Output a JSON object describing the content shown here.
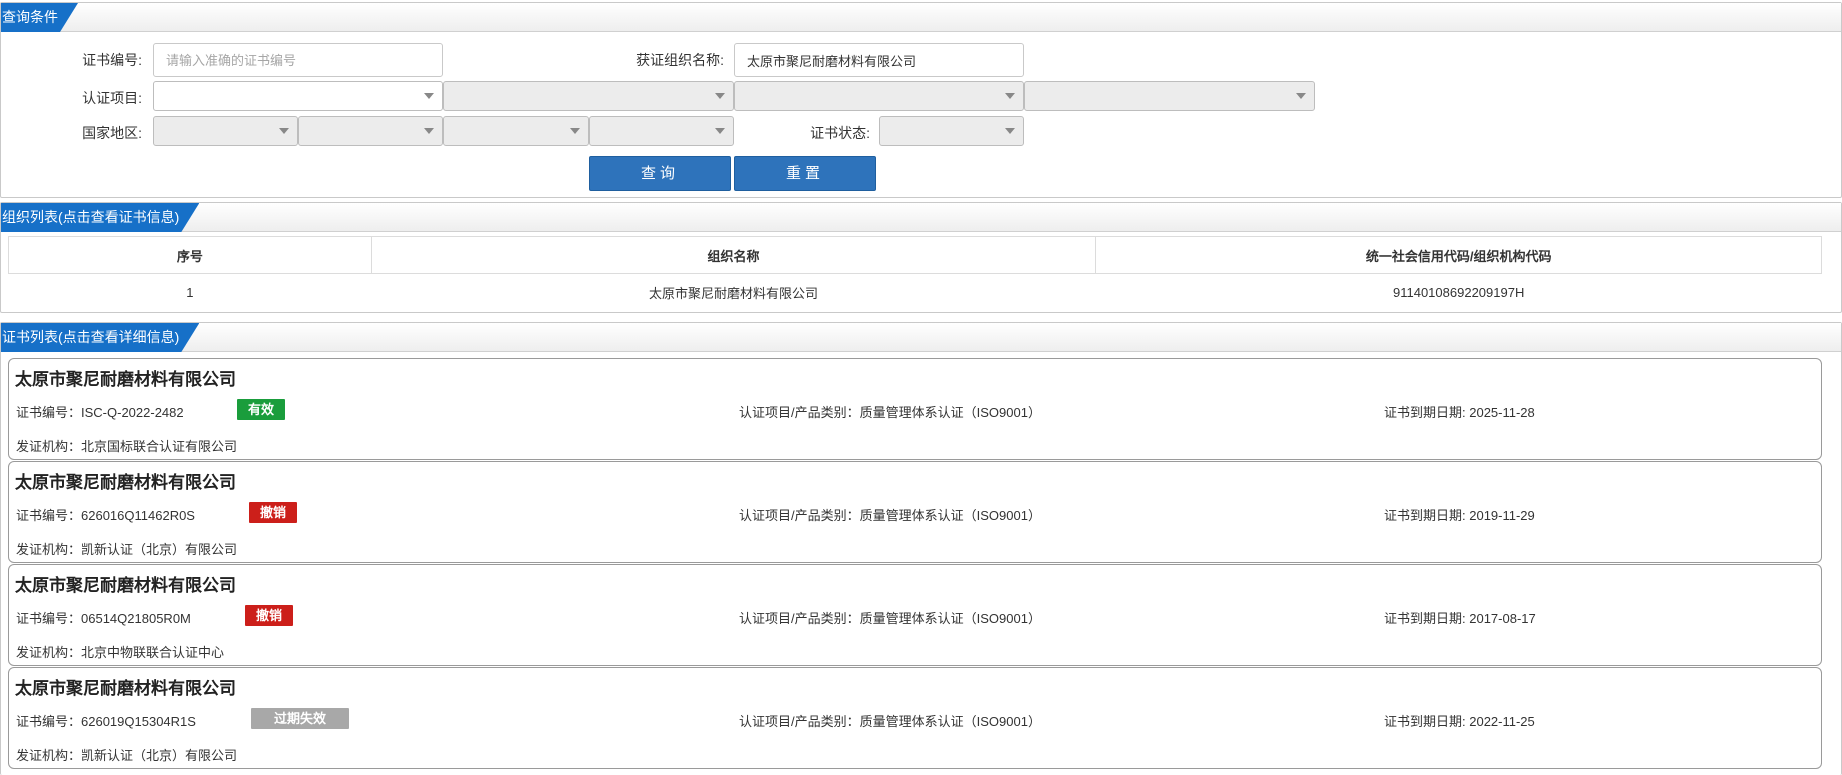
{
  "query_panel": {
    "title": "查询条件",
    "cert_no_label": "证书编号:",
    "cert_no_placeholder": "请输入准确的证书编号",
    "org_name_label": "获证组织名称:",
    "org_name_value": "太原市聚尼耐磨材料有限公司",
    "cert_item_label": "认证项目:",
    "country_label": "国家地区:",
    "cert_status_label": "证书状态:",
    "query_button": "查询",
    "reset_button": "重置"
  },
  "org_panel": {
    "title": "组织列表(点击查看证书信息)",
    "columns": [
      "序号",
      "组织名称",
      "统一社会信用代码/组织机构代码"
    ],
    "rows": [
      {
        "index": "1",
        "name": "太原市聚尼耐磨材料有限公司",
        "code": "91140108692209197H"
      }
    ]
  },
  "cert_panel": {
    "title": "证书列表(点击查看详细信息)",
    "cert_no_prefix": "证书编号：",
    "item_prefix": "认证项目/产品类别：",
    "expiry_prefix": "证书到期日期: ",
    "issuer_prefix": "发证机构：",
    "cards": [
      {
        "org": "太原市聚尼耐磨材料有限公司",
        "cert_no": "ISC-Q-2022-2482",
        "status": "有效",
        "status_color": "#1a9d3c",
        "item": "质量管理体系认证（ISO9001）",
        "expiry": "2025-11-28",
        "issuer": "北京国标联合认证有限公司"
      },
      {
        "org": "太原市聚尼耐磨材料有限公司",
        "cert_no": "626016Q11462R0S",
        "status": "撤销",
        "status_color": "#cc1f1a",
        "item": "质量管理体系认证（ISO9001）",
        "expiry": "2019-11-29",
        "issuer": "凯新认证（北京）有限公司"
      },
      {
        "org": "太原市聚尼耐磨材料有限公司",
        "cert_no": "06514Q21805R0M",
        "status": "撤销",
        "status_color": "#cc1f1a",
        "item": "质量管理体系认证（ISO9001）",
        "expiry": "2017-08-17",
        "issuer": "北京中物联联合认证中心"
      },
      {
        "org": "太原市聚尼耐磨材料有限公司",
        "cert_no": "626019Q15304R1S",
        "status": "过期失效",
        "status_color": "#a8a8a8",
        "item": "质量管理体系认证（ISO9001）",
        "expiry": "2022-11-25",
        "issuer": "凯新认证（北京）有限公司"
      }
    ]
  }
}
